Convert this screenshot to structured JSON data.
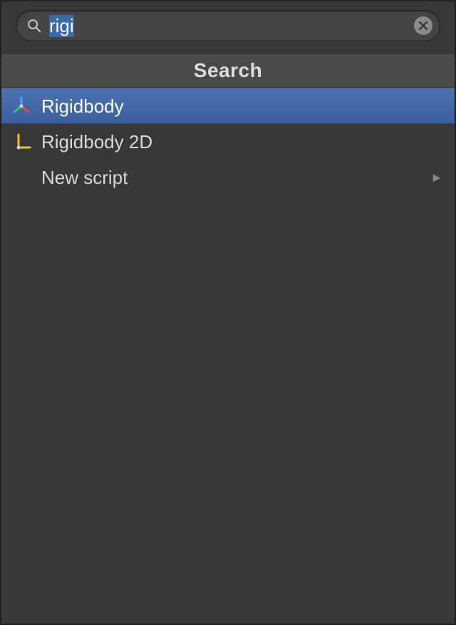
{
  "search": {
    "query": "rigi",
    "placeholder": ""
  },
  "header": {
    "title": "Search"
  },
  "results": [
    {
      "label": "Rigidbody",
      "icon": "rigidbody-3d-icon",
      "selected": true,
      "has_submenu": false
    },
    {
      "label": "Rigidbody 2D",
      "icon": "rigidbody-2d-icon",
      "selected": false,
      "has_submenu": false
    },
    {
      "label": "New script",
      "icon": "",
      "selected": false,
      "has_submenu": true
    }
  ],
  "icons": {
    "arrow": "►"
  }
}
